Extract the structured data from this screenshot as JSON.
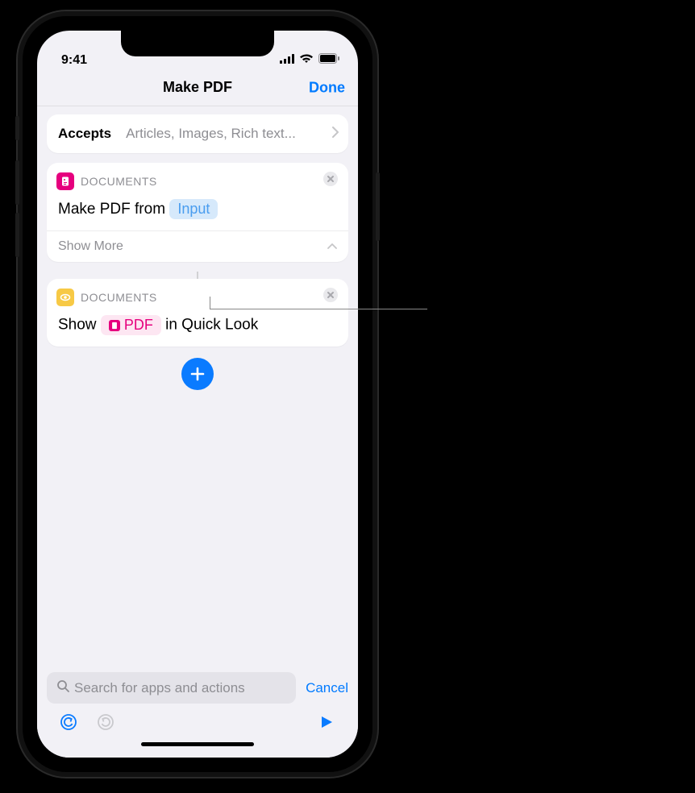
{
  "statusbar": {
    "time": "9:41"
  },
  "nav": {
    "title": "Make PDF",
    "done": "Done"
  },
  "accepts": {
    "label": "Accepts",
    "value": "Articles, Images, Rich text..."
  },
  "action1": {
    "category": "DOCUMENTS",
    "line_prefix": "Make PDF from",
    "token": "Input",
    "showmore": "Show More"
  },
  "action2": {
    "category": "DOCUMENTS",
    "line_prefix": "Show",
    "token": "PDF",
    "line_suffix": "in Quick Look"
  },
  "search": {
    "placeholder": "Search for apps and actions",
    "cancel": "Cancel"
  }
}
